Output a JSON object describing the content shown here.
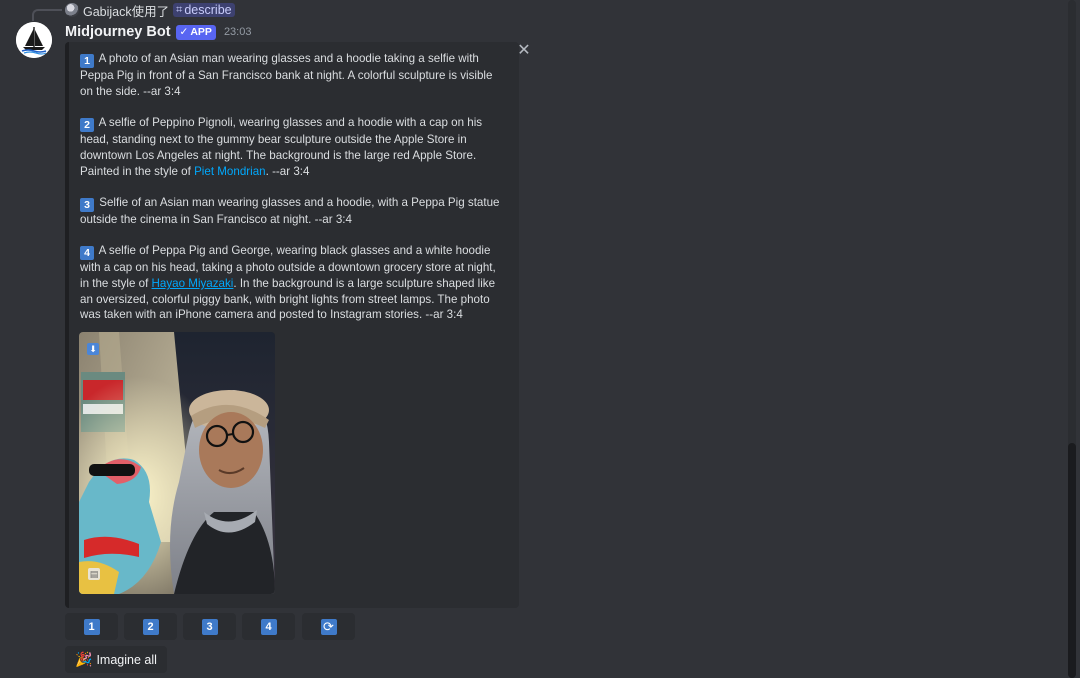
{
  "reply": {
    "user": "Gabijack",
    "action": "使用了",
    "command": "describe"
  },
  "message": {
    "username": "Midjourney Bot",
    "badge": "APP",
    "timestamp": "23:03"
  },
  "embed": {
    "close_label": "✕",
    "descriptions": [
      {
        "num": "1",
        "text": "A photo of an Asian man wearing glasses and a hoodie taking a selfie with Peppa Pig in front of a San Francisco bank at night. A colorful sculpture is visible on the side. --ar 3:4"
      },
      {
        "num": "2",
        "text_before": "A selfie of Peppino Pignoli, wearing glasses and a hoodie with a cap on his head, standing next to the gummy bear sculpture outside the Apple Store in downtown Los Angeles at night. The background is the large red Apple Store. Painted in the style of ",
        "link": "Piet Mondrian",
        "text_after": ". --ar 3:4"
      },
      {
        "num": "3",
        "text": "Selfie of an Asian man wearing glasses and a hoodie, with a Peppa Pig statue outside the cinema in San Francisco at night. --ar 3:4"
      },
      {
        "num": "4",
        "text_before": "A selfie of Peppa Pig and George, wearing black glasses and a white hoodie with a cap on his head, taking a photo outside a downtown grocery store at night, in the style of ",
        "link": "Hayao Miyazaki",
        "text_after": ". In the background is a large sculpture shaped like an oversized, colorful piggy bank, with bright lights from street lamps. The photo was taken with an iPhone camera and posted to Instagram stories. --ar 3:4"
      }
    ],
    "image_icons": {
      "download": "⬇",
      "doc": "▤"
    }
  },
  "buttons": {
    "numbers": [
      "1",
      "2",
      "3",
      "4"
    ],
    "reroll_glyph": "⟳",
    "imagine_emoji": "🎉",
    "imagine_label": "Imagine all"
  },
  "colors": {
    "background": "#313338",
    "embed": "#2b2d31",
    "blurple": "#5865f2",
    "keycap": "#3f7ac9",
    "link": "#00a8fc"
  }
}
